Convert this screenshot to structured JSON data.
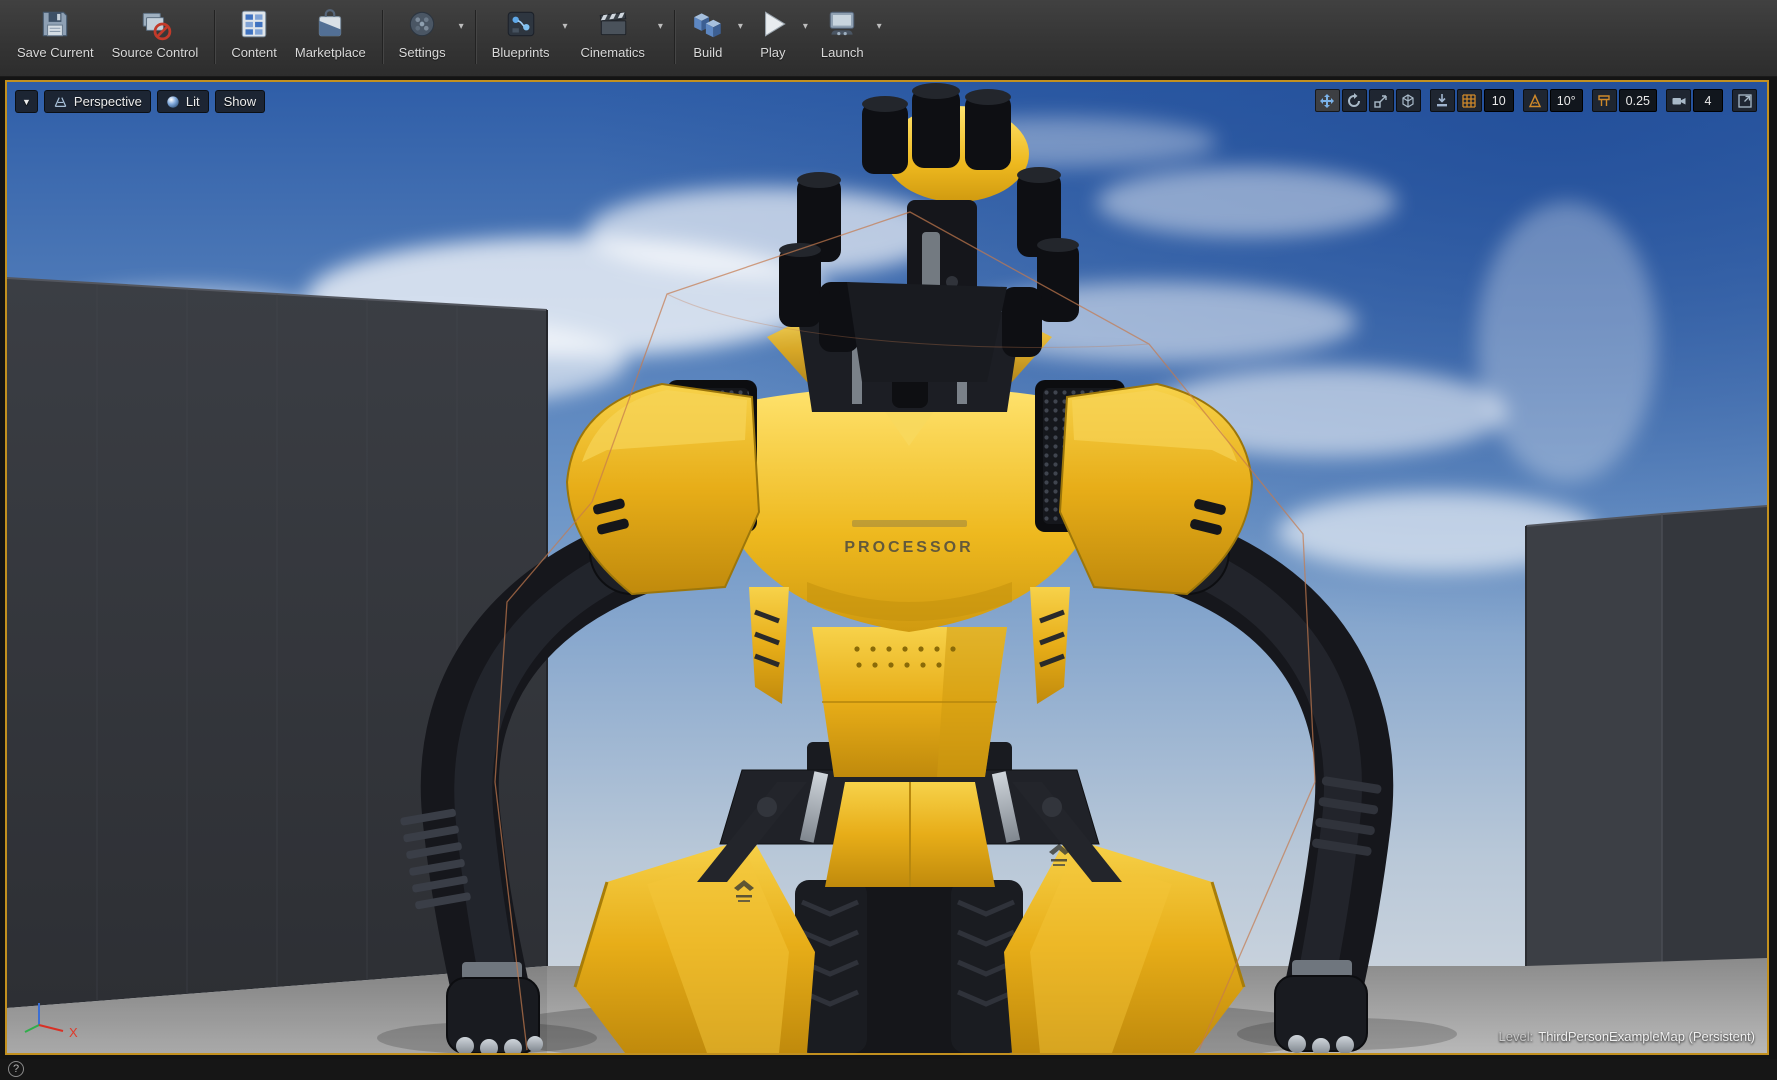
{
  "toolbar": {
    "items": [
      {
        "label": "Save Current",
        "dropdown": false
      },
      {
        "label": "Source Control",
        "dropdown": false
      },
      {
        "label": "Content",
        "dropdown": false
      },
      {
        "label": "Marketplace",
        "dropdown": false
      },
      {
        "label": "Settings",
        "dropdown": true
      },
      {
        "label": "Blueprints",
        "dropdown": true
      },
      {
        "label": "Cinematics",
        "dropdown": true
      },
      {
        "label": "Build",
        "dropdown": true
      },
      {
        "label": "Play",
        "dropdown": true
      },
      {
        "label": "Launch",
        "dropdown": true
      }
    ]
  },
  "icons": {
    "caret_down": "▾",
    "viewport_caret": "▼",
    "help": "?"
  },
  "viewport": {
    "view_mode_label": "Perspective",
    "lit_label": "Lit",
    "show_label": "Show",
    "grid_snap_value": "10",
    "rotation_snap_value": "10°",
    "scale_snap_value": "0.25",
    "camera_speed_value": "4",
    "level_prefix": "Level:",
    "level_name": "ThirdPersonExampleMap (Persistent)"
  },
  "scene": {
    "chest_text": "PROCESSOR",
    "axis_x_label": "X"
  },
  "colors": {
    "viewport_border": "#c2901f",
    "selection_outline": "#c57a4e",
    "robot_yellow": "#e9b422",
    "sky_top": "#2f5ea8",
    "snap_icon_orange": "#d08a2a"
  }
}
